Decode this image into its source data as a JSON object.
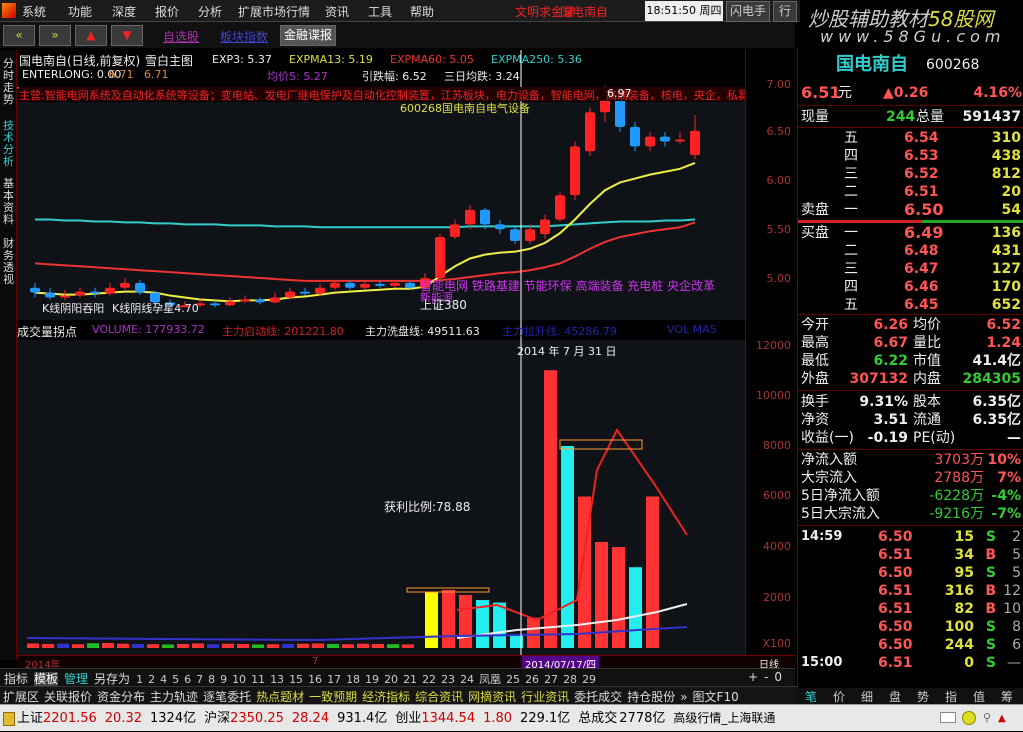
{
  "menu": [
    "系统",
    "功能",
    "深度",
    "报价",
    "分析",
    "扩展市场行情",
    "资讯",
    "工具",
    "帮助"
  ],
  "menu_red": [
    "文明求金录",
    "国电南自"
  ],
  "clock": "18:51:50 周四",
  "menu_right": [
    "闪电手",
    "行情"
  ],
  "watermark": {
    "line1": "炒股辅助教材",
    "brand": "58股网",
    "line2": "www.58Gu.com"
  },
  "toolbar": {
    "back": "«",
    "fwd": "»",
    "up": "▲",
    "down": "▼",
    "zxg": "自选股",
    "bkzs": "板块指数",
    "jrdb": "金融谍报"
  },
  "left_tabs": [
    "分时走势",
    "技术分析",
    "基本资料",
    "财务透视"
  ],
  "chart": {
    "title": "国电南自(日线,前复权)",
    "main": "雪白主图",
    "exp3": "EXP3: 5.37",
    "expma13": "EXPMA13: 5.19",
    "expma60": "EXPMA60: 5.05",
    "expma250": "EXPMA250: 5.36",
    "enterlong": "ENTERLONG: 0.00",
    "v1": "6.71",
    "v2": "6.71",
    "jj5": "均价5: 5.27",
    "yzf": "引跌幅: 6.52",
    "srjd": "三日均跌: 3.24",
    "news": "主营:智能电网系统及自动化系统等设备；变电站、发电厂继电保护及自动化控制装置，江苏板块，电力设备，智能电网，高端装备，核电，央企，私募",
    "code_line": "600268国电南自电气设备",
    "high_label": "6.97",
    "concepts": "智能电网 铁路基建 节能环保 高端装备 充电桩 央企改革",
    "concept2": "新能源",
    "index_note": "上证380",
    "notes": [
      "K线阴阳吞阳",
      "K线阴线孕星4.70"
    ],
    "price_axis": [
      "7.00",
      "6.50",
      "6.00",
      "5.50",
      "5.00"
    ],
    "candles": [
      [
        4.9,
        4.85,
        4.95,
        4.8
      ],
      [
        4.85,
        4.8,
        4.9,
        4.78
      ],
      [
        4.8,
        4.82,
        4.88,
        4.77
      ],
      [
        4.82,
        4.86,
        4.9,
        4.8
      ],
      [
        4.86,
        4.84,
        4.9,
        4.8
      ],
      [
        4.84,
        4.9,
        4.95,
        4.82
      ],
      [
        4.9,
        4.95,
        5.0,
        4.88
      ],
      [
        4.95,
        4.85,
        4.98,
        4.83
      ],
      [
        4.85,
        4.75,
        4.86,
        4.72
      ],
      [
        4.75,
        4.72,
        4.78,
        4.7
      ],
      [
        4.72,
        4.72,
        4.76,
        4.7
      ],
      [
        4.72,
        4.74,
        4.78,
        4.7
      ],
      [
        4.74,
        4.72,
        4.77,
        4.7
      ],
      [
        4.72,
        4.76,
        4.8,
        4.71
      ],
      [
        4.76,
        4.78,
        4.82,
        4.74
      ],
      [
        4.78,
        4.75,
        4.8,
        4.73
      ],
      [
        4.75,
        4.8,
        4.85,
        4.74
      ],
      [
        4.8,
        4.86,
        4.9,
        4.78
      ],
      [
        4.86,
        4.84,
        4.9,
        4.82
      ],
      [
        4.84,
        4.9,
        4.94,
        4.82
      ],
      [
        4.9,
        4.95,
        4.98,
        4.88
      ],
      [
        4.95,
        4.9,
        4.98,
        4.88
      ],
      [
        4.9,
        4.94,
        4.97,
        4.88
      ],
      [
        4.94,
        4.92,
        4.97,
        4.9
      ],
      [
        4.92,
        4.95,
        4.98,
        4.9
      ],
      [
        4.95,
        4.9,
        4.97,
        4.88
      ],
      [
        4.9,
        5.0,
        5.05,
        4.88
      ],
      [
        5.0,
        5.42,
        5.45,
        4.98
      ],
      [
        5.42,
        5.55,
        5.6,
        5.4
      ],
      [
        5.55,
        5.7,
        5.75,
        5.5
      ],
      [
        5.7,
        5.55,
        5.72,
        5.5
      ],
      [
        5.55,
        5.5,
        5.6,
        5.45
      ],
      [
        5.5,
        5.38,
        5.52,
        5.35
      ],
      [
        5.38,
        5.5,
        5.55,
        5.35
      ],
      [
        5.45,
        5.6,
        5.65,
        5.4
      ],
      [
        5.6,
        5.85,
        5.88,
        5.58
      ],
      [
        5.85,
        6.35,
        6.4,
        5.8
      ],
      [
        6.3,
        6.7,
        6.75,
        6.25
      ],
      [
        6.7,
        6.95,
        6.97,
        6.6
      ],
      [
        6.9,
        6.55,
        6.92,
        6.5
      ],
      [
        6.55,
        6.35,
        6.6,
        6.3
      ],
      [
        6.35,
        6.45,
        6.5,
        6.3
      ],
      [
        6.45,
        6.4,
        6.5,
        6.35
      ],
      [
        6.4,
        6.42,
        6.5,
        6.38
      ],
      [
        6.26,
        6.51,
        6.67,
        6.22
      ]
    ],
    "exp_yellow": [
      4.85,
      4.84,
      4.83,
      4.83,
      4.84,
      4.85,
      4.86,
      4.86,
      4.85,
      4.82,
      4.8,
      4.78,
      4.77,
      4.76,
      4.77,
      4.77,
      4.78,
      4.8,
      4.81,
      4.83,
      4.85,
      4.86,
      4.87,
      4.88,
      4.89,
      4.89,
      4.91,
      5.02,
      5.12,
      5.2,
      5.24,
      5.26,
      5.27,
      5.3,
      5.36,
      5.46,
      5.6,
      5.76,
      5.9,
      5.98,
      6.02,
      6.06,
      6.09,
      6.12,
      6.18
    ],
    "exp_red": [
      5.15,
      5.14,
      5.13,
      5.12,
      5.11,
      5.1,
      5.09,
      5.08,
      5.07,
      5.06,
      5.05,
      5.04,
      5.03,
      5.02,
      5.01,
      5.0,
      4.99,
      4.98,
      4.97,
      4.97,
      4.97,
      4.97,
      4.97,
      4.97,
      4.97,
      4.97,
      4.97,
      4.98,
      4.99,
      5.01,
      5.03,
      5.05,
      5.06,
      5.08,
      5.11,
      5.15,
      5.22,
      5.3,
      5.37,
      5.42,
      5.45,
      5.48,
      5.5,
      5.52,
      5.57
    ],
    "exp_cyan": [
      5.6,
      5.6,
      5.59,
      5.59,
      5.58,
      5.58,
      5.57,
      5.57,
      5.56,
      5.56,
      5.55,
      5.55,
      5.55,
      5.54,
      5.54,
      5.54,
      5.53,
      5.53,
      5.53,
      5.52,
      5.52,
      5.52,
      5.52,
      5.52,
      5.52,
      5.52,
      5.52,
      5.52,
      5.52,
      5.53,
      5.53,
      5.53,
      5.53,
      5.53,
      5.53,
      5.54,
      5.55,
      5.56,
      5.57,
      5.58,
      5.58,
      5.58,
      5.59,
      5.59,
      5.6
    ]
  },
  "volume": {
    "title": "成交量拐点",
    "volume": "VOLUME: 177933.72",
    "zlqd": "主力启动线: 201221.80",
    "zlxp": "主力洗盘线: 49511.63",
    "extra": "主力拉升线: 45286.79",
    "extra2": "VOL MA5",
    "date_tip": "2014 年 7 月 31 日",
    "ratio": "获利比例:78.88",
    "axis": [
      "12000",
      "10000",
      "8000",
      "6000",
      "4000",
      "2000",
      "X100"
    ],
    "bars": [
      180,
      160,
      170,
      150,
      190,
      200,
      170,
      160,
      150,
      140,
      160,
      180,
      150,
      170,
      160,
      140,
      150,
      160,
      170,
      180,
      160,
      150,
      170,
      160,
      150,
      140,
      2200,
      2300,
      2100,
      1900,
      1800,
      500,
      1200,
      11000,
      8000,
      6000,
      4200,
      4000,
      3200,
      6000
    ],
    "bar_colors": [
      "r",
      "r",
      "b",
      "r",
      "g",
      "r",
      "r",
      "b",
      "r",
      "g",
      "r",
      "r",
      "b",
      "r",
      "r",
      "g",
      "r",
      "b",
      "r",
      "r",
      "g",
      "r",
      "r",
      "r",
      "g",
      "r",
      "y",
      "r",
      "r",
      "c",
      "c",
      "c",
      "r",
      "r",
      "c",
      "r",
      "r",
      "r",
      "c",
      "r"
    ]
  },
  "datebar": {
    "left": "2014年",
    "mid": "7",
    "sel": "2014/07/17/四",
    "right": "日线"
  },
  "tabs": [
    "指标",
    "模板",
    "管理",
    "另存为",
    "1",
    "2",
    "4",
    "5",
    "6",
    "7",
    "8",
    "9",
    "10",
    "11",
    "13",
    "15",
    "16",
    "17",
    "18",
    "19",
    "20",
    "21",
    "22",
    "23",
    "24",
    "凤凰",
    "25",
    "26",
    "27",
    "28",
    "29"
  ],
  "tab_ctrl": [
    "+",
    "-",
    "0"
  ],
  "func": [
    "扩展区",
    "关联报价",
    "资金分布",
    "主力轨迹",
    "逐笔委托",
    "热点题材",
    "一致预期",
    "经济指标",
    "综合资讯",
    "网摘资讯",
    "行业资讯",
    "委托成交",
    "持仓股份",
    "»",
    "图文F10"
  ],
  "status": {
    "sh": "上证",
    "sh_v": "2201.56",
    "sh_c": "20.32",
    "sh_a": "1324亿",
    "hs": "沪深",
    "hs_v": "2350.25",
    "hs_c": "28.24",
    "hs_a": "931.4亿",
    "cy": "创业",
    "cy_v": "1344.54",
    "cy_c": "1.80",
    "cy_a": "229.1亿",
    "total": "总成交",
    "total_v": "2778亿",
    "feed": "高级行情_上海联通"
  },
  "quote": {
    "name": "国电南自",
    "code": "600268",
    "price": "6.51",
    "unit": "元",
    "chg": "▲0.26",
    "pct": "4.16%",
    "xl_label": "现量",
    "xl": "244",
    "zl_label": "总量",
    "zl": "591437",
    "asks": [
      [
        "五",
        "6.54",
        "310"
      ],
      [
        "四",
        "6.53",
        "438"
      ],
      [
        "三",
        "6.52",
        "812"
      ],
      [
        "二",
        "6.51",
        "20"
      ],
      [
        "一",
        "6.50",
        "54"
      ]
    ],
    "bids": [
      [
        "一",
        "6.49",
        "136"
      ],
      [
        "二",
        "6.48",
        "431"
      ],
      [
        "三",
        "6.47",
        "127"
      ],
      [
        "四",
        "6.46",
        "170"
      ],
      [
        "五",
        "6.45",
        "652"
      ]
    ],
    "sell_label": "卖盘",
    "buy_label": "买盘",
    "stats": [
      [
        "今开",
        "6.26",
        "均价",
        "6.52"
      ],
      [
        "最高",
        "6.67",
        "量比",
        "1.24"
      ],
      [
        "最低",
        "6.22",
        "市值",
        "41.4亿"
      ],
      [
        "外盘",
        "307132",
        "内盘",
        "284305"
      ]
    ],
    "stats2": [
      [
        "换手",
        "9.31%",
        "股本",
        "6.35亿"
      ],
      [
        "净资",
        "3.51",
        "流通",
        "6.35亿"
      ],
      [
        "收益(一)",
        "-0.19",
        "PE(动)",
        "—"
      ]
    ],
    "flows": [
      [
        "净流入额",
        "3703万",
        "10%"
      ],
      [
        "大宗流入",
        "2788万",
        "7%"
      ],
      [
        "5日净流入额",
        "-6228万",
        "-4%"
      ],
      [
        "5日大宗流入",
        "-9216万",
        "-7%"
      ]
    ],
    "ticks": [
      [
        "14:59",
        "6.50",
        "15",
        "S",
        "2"
      ],
      [
        "",
        "6.51",
        "34",
        "B",
        "5"
      ],
      [
        "",
        "6.50",
        "95",
        "S",
        "5"
      ],
      [
        "",
        "6.51",
        "316",
        "B",
        "12"
      ],
      [
        "",
        "6.51",
        "82",
        "B",
        "10"
      ],
      [
        "",
        "6.50",
        "100",
        "S",
        "8"
      ],
      [
        "",
        "6.50",
        "244",
        "S",
        "6"
      ],
      [
        "15:00",
        "6.51",
        "0",
        "S",
        "—"
      ]
    ],
    "tabs": [
      "笔",
      "价",
      "细",
      "盘",
      "势",
      "指",
      "值",
      "筹"
    ]
  }
}
